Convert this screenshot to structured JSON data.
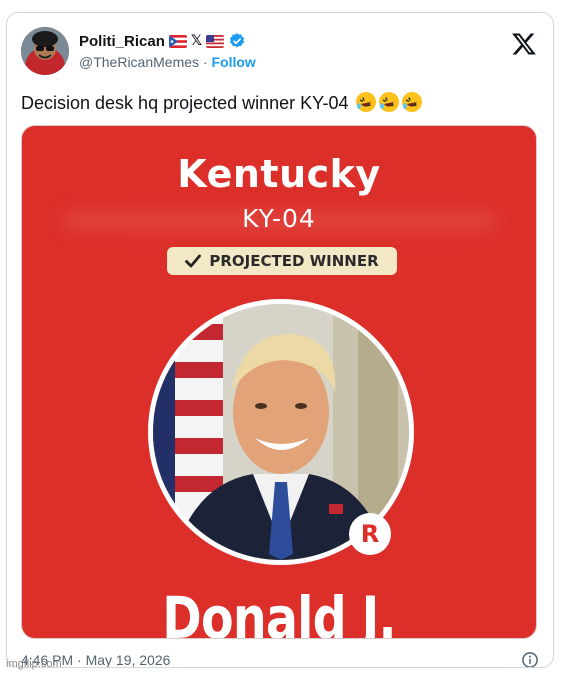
{
  "tweet": {
    "display_name": "Politi_Rican",
    "handle": "@TheRicanMemes",
    "separator": "·",
    "follow_label": "Follow",
    "text": "Decision desk hq projected winner KY-04",
    "emoji_names": [
      "rolling-on-floor-laughing-icon",
      "rolling-on-floor-laughing-icon",
      "rolling-on-floor-laughing-icon"
    ],
    "name_badges": [
      "puerto-rico-flag-icon",
      "x-icon",
      "usa-flag-icon",
      "verified-badge-icon"
    ],
    "timestamp": "4:46 PM · May 19, 2026"
  },
  "media": {
    "state": "Kentucky",
    "district": "KY-04",
    "badge_label": "PROJECTED WINNER",
    "party_badge": "R",
    "candidate_name": "Donald J."
  },
  "watermark": "imgflip.com",
  "colors": {
    "link": "#1d9bf0",
    "media_background": "#dc2f2a",
    "badge_background": "#f3e8c6",
    "verified": "#1d9bf0"
  }
}
